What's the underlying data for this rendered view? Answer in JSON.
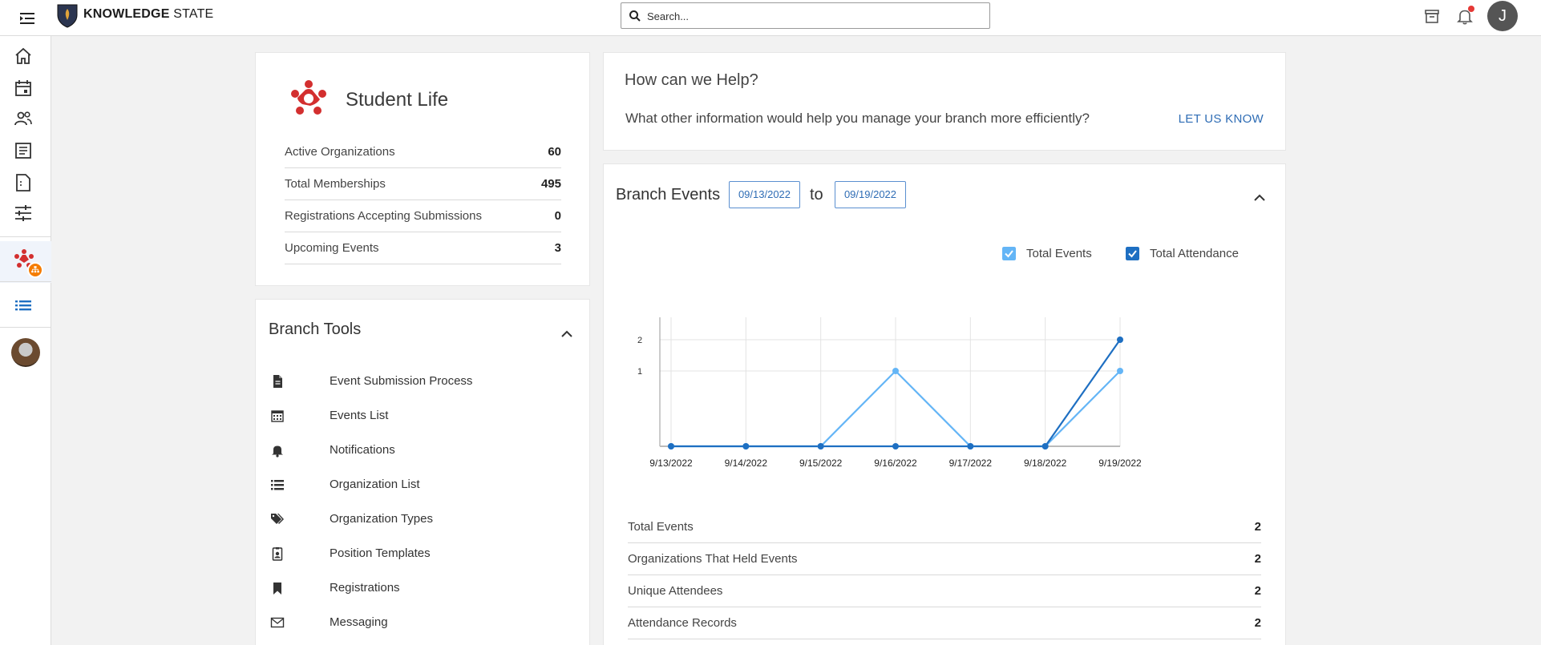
{
  "app": {
    "brand_bold": "KNOWLEDGE",
    "brand_rest": "STATE"
  },
  "search": {
    "placeholder": "Search..."
  },
  "user": {
    "initial": "J"
  },
  "student_life": {
    "title": "Student Life",
    "stats": [
      {
        "label": "Active Organizations",
        "value": "60"
      },
      {
        "label": "Total Memberships",
        "value": "495"
      },
      {
        "label": "Registrations Accepting Submissions",
        "value": "0"
      },
      {
        "label": "Upcoming Events",
        "value": "3"
      }
    ]
  },
  "branch_tools": {
    "title": "Branch Tools",
    "items": [
      {
        "label": "Event Submission Process",
        "icon": "document-icon"
      },
      {
        "label": "Events List",
        "icon": "calendar-icon"
      },
      {
        "label": "Notifications",
        "icon": "bell-icon"
      },
      {
        "label": "Organization List",
        "icon": "list-icon"
      },
      {
        "label": "Organization Types",
        "icon": "tags-icon"
      },
      {
        "label": "Position Templates",
        "icon": "id-badge-icon"
      },
      {
        "label": "Registrations",
        "icon": "bookmark-icon"
      },
      {
        "label": "Messaging",
        "icon": "envelope-icon"
      }
    ]
  },
  "help": {
    "title": "How can we Help?",
    "text": "What other information would help you manage your branch more efficiently?",
    "link": "LET US KNOW"
  },
  "branch_events": {
    "title": "Branch Events",
    "date_from": "09/13/2022",
    "to_label": "to",
    "date_to": "09/19/2022",
    "legend": [
      {
        "label": "Total Events",
        "color": "#64b5f6"
      },
      {
        "label": "Total Attendance",
        "color": "#1e6fc2"
      }
    ],
    "stats": [
      {
        "label": "Total Events",
        "value": "2"
      },
      {
        "label": "Organizations That Held Events",
        "value": "2"
      },
      {
        "label": "Unique Attendees",
        "value": "2"
      },
      {
        "label": "Attendance Records",
        "value": "2"
      }
    ]
  },
  "chart_data": {
    "type": "line",
    "x": [
      "9/13/2022",
      "9/14/2022",
      "9/15/2022",
      "9/16/2022",
      "9/17/2022",
      "9/18/2022",
      "9/19/2022"
    ],
    "series": [
      {
        "name": "Total Events",
        "color": "#64b5f6",
        "values": [
          0,
          0,
          0,
          1,
          0,
          0,
          1
        ]
      },
      {
        "name": "Total Attendance",
        "color": "#1e6fc2",
        "values": [
          0,
          0,
          0,
          0,
          0,
          0,
          2
        ]
      }
    ],
    "y_ticks": [
      "1",
      "2"
    ],
    "grid": true,
    "legend_position": "top-right"
  }
}
